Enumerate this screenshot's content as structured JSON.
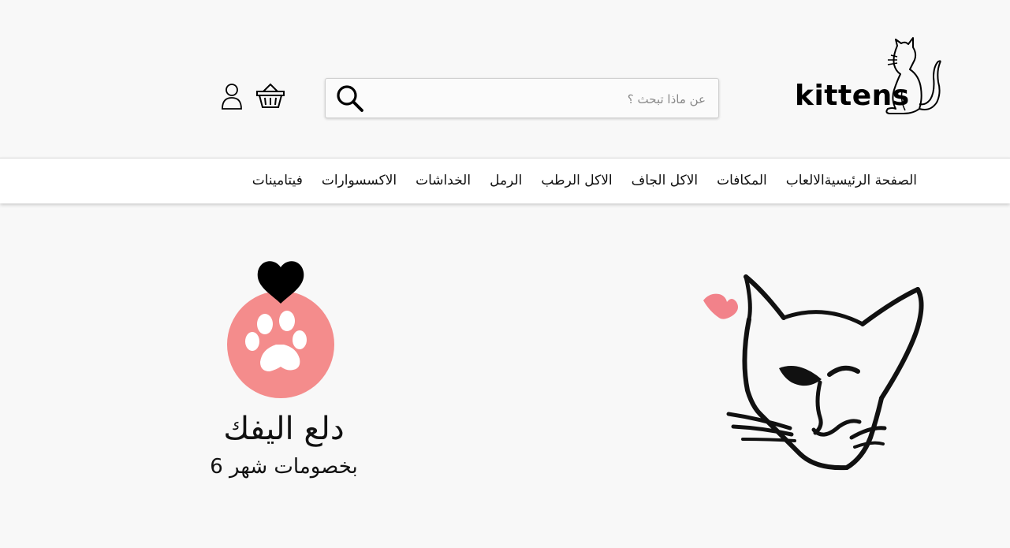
{
  "header": {
    "logo_text": "kittens",
    "search": {
      "placeholder": "عن ماذا تبحث ؟"
    },
    "icons": [
      "search-icon",
      "basket-icon",
      "user-icon"
    ]
  },
  "nav": {
    "items": [
      "الصفحة الرئيسية",
      "الالعاب",
      "المكافات",
      "الاكل الجاف",
      "الاكل الرطب",
      "الرمل",
      "الخداشات",
      "الاكسسوارات",
      "فيتامينات"
    ]
  },
  "promo": {
    "title": "دلع اليفك",
    "subtitle": "بخصومات شهر 6"
  },
  "colors": {
    "background": "#f8f8f8",
    "paw_circle": "#f48c8c",
    "heart_pink": "#f2828a",
    "heart_black": "#000000"
  }
}
